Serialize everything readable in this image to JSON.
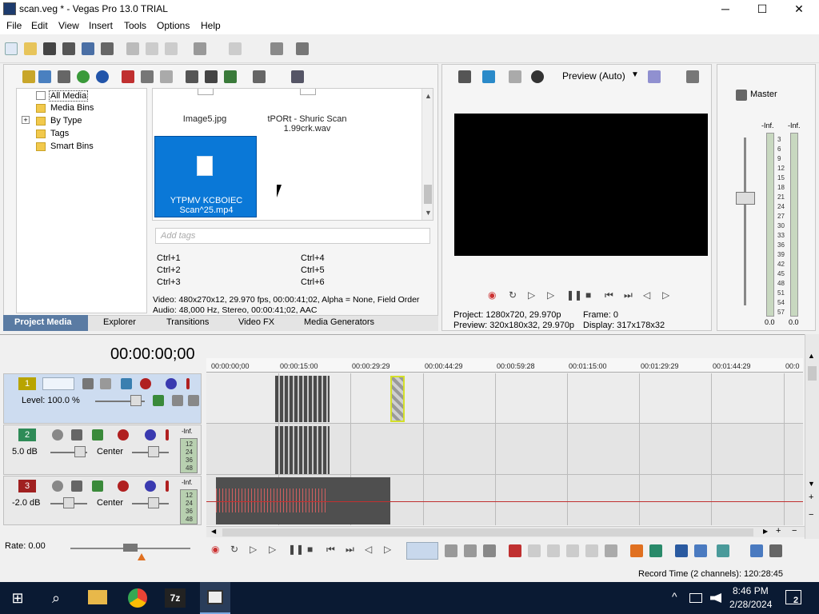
{
  "window": {
    "title": "scan.veg * - Vegas Pro 13.0 TRIAL",
    "min": "─",
    "max": "☐",
    "close": "✕"
  },
  "menu": [
    "File",
    "Edit",
    "View",
    "Insert",
    "Tools",
    "Options",
    "Help"
  ],
  "explorer_tree": {
    "items": [
      "All Media",
      "Media Bins",
      "By Type",
      "Tags",
      "Smart Bins"
    ],
    "expand": "+"
  },
  "media": {
    "items": [
      {
        "label": "Image5.jpg"
      },
      {
        "label": "tPORt - Shuric Scan 1.99crk.wav"
      },
      {
        "label": "YTPMV KCBOIEC Scan^25.mp4"
      }
    ],
    "tags_placeholder": "Add tags",
    "shortcuts": [
      "Ctrl+1",
      "Ctrl+4",
      "Ctrl+2",
      "Ctrl+5",
      "Ctrl+3",
      "Ctrl+6"
    ],
    "info_video": "Video: 480x270x12, 29.970 fps, 00:00:41;02, Alpha = None, Field Order",
    "info_audio": "Audio: 48,000 Hz, Stereo, 00:00:41;02, AAC"
  },
  "tabs": [
    "Project Media",
    "Explorer",
    "Transitions",
    "Video FX",
    "Media Generators"
  ],
  "preview": {
    "mode": "Preview (Auto)",
    "project": "Project:   1280x720, 29.970p",
    "frame": "Frame:     0",
    "preview": "Preview:  320x180x32, 29.970p",
    "display": "Display:   317x178x32"
  },
  "master": {
    "title": "Master",
    "inf_left": "-Inf.",
    "inf_right": "-Inf.",
    "scale": [
      "3",
      "6",
      "9",
      "12",
      "15",
      "18",
      "21",
      "24",
      "27",
      "30",
      "33",
      "36",
      "39",
      "42",
      "45",
      "48",
      "51",
      "54",
      "57"
    ],
    "bottom_left": "0.0",
    "bottom_right": "0.0"
  },
  "timeline": {
    "timecode": "00:00:00;00",
    "ruler": [
      "00:00:00;00",
      "00:00:15:00",
      "00:00:29:29",
      "00:00:44:29",
      "00:00:59:28",
      "00:01:15:00",
      "00:01:29:29",
      "00:01:44:29",
      "00:0"
    ],
    "rate": "Rate: 0.00",
    "record_time": "Record Time (2 channels): 120:28:45"
  },
  "tracks": [
    {
      "num": "1",
      "level": "Level: 100.0 %",
      "color": "#b8a400"
    },
    {
      "num": "2",
      "db": "5.0 dB",
      "pan": "Center",
      "color": "#2e8b57",
      "inf": "-Inf.",
      "meter": [
        "12",
        "24",
        "36",
        "48"
      ]
    },
    {
      "num": "3",
      "db": "-2.0 dB",
      "pan": "Center",
      "color": "#a02020",
      "inf": "-Inf.",
      "meter": [
        "12",
        "24",
        "36",
        "48"
      ]
    }
  ],
  "taskbar": {
    "time": "8:46 PM",
    "date": "2/28/2024",
    "notifications": "2",
    "chevron": "^"
  },
  "colors": {
    "accent": "#1e90ff",
    "selection": "#0a78d7"
  }
}
